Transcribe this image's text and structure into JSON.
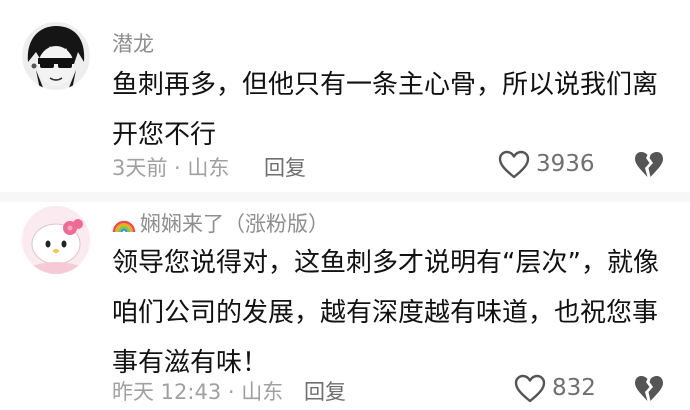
{
  "comments": [
    {
      "username": "潜龙",
      "content": "鱼刺再多，但他只有一条主心骨，所以说我们离开您不行",
      "time_location": "3天前 · 山东",
      "reply_label": "回复",
      "likes": "3936"
    },
    {
      "username": "娴娴来了（涨粉版）",
      "content": "领导您说得对，这鱼刺多才说明有“层次”，就像咱们公司的发展，越有深度越有味道，也祝您事事有滋有味！",
      "time_location": "昨天 12:43 · 山东",
      "reply_label": "回复",
      "likes": "832"
    }
  ],
  "icons": {
    "like": "heart-outline-icon",
    "dislike": "broken-heart-icon",
    "badge": "rainbow-icon"
  },
  "colors": {
    "username": "#8e8e8e",
    "meta": "#a0a0a0",
    "action": "#6f6f6f"
  }
}
